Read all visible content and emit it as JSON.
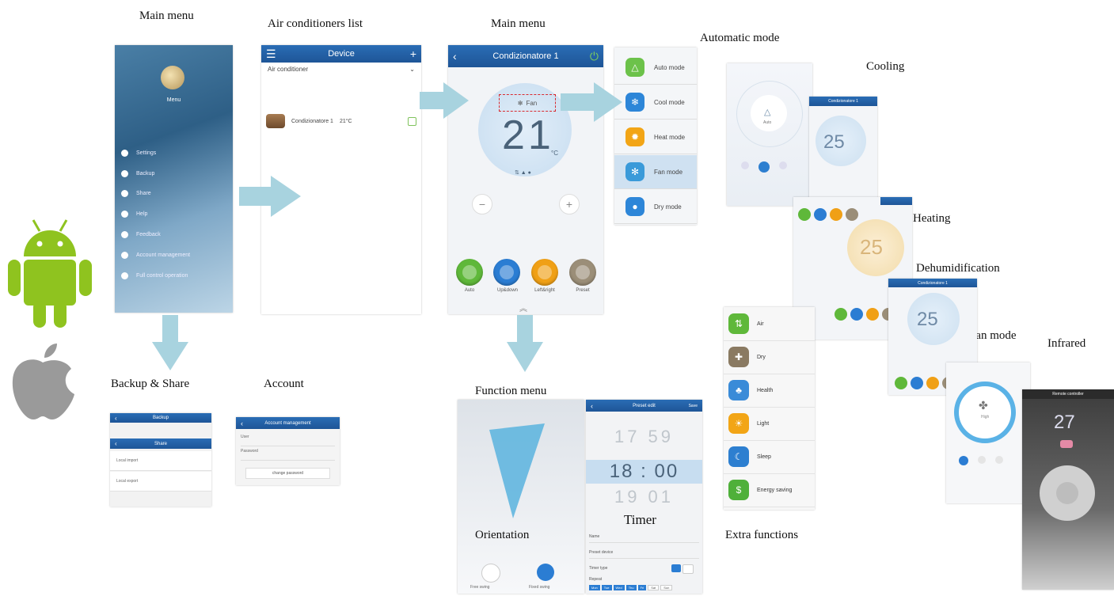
{
  "captions": {
    "main_menu_1": "Main menu",
    "ac_list": "Air conditioners list",
    "main_menu_2": "Main menu",
    "automatic_mode": "Automatic  mode",
    "cooling": "Cooling",
    "heating": "Heating",
    "dehumidification": "Dehumidification",
    "fan_mode": "Fan mode",
    "infrared": "Infrared",
    "backup_share": "Backup & Share",
    "account": "Account",
    "function_menu": "Function menu",
    "orientation": "Orientation",
    "timer": "Timer",
    "extra_functions": "Extra functions"
  },
  "side_menu": {
    "user": "Menu",
    "items": [
      "Settings",
      "Backup",
      "Share",
      "Help",
      "Feedback",
      "Account management",
      "Full control operation"
    ]
  },
  "device_list": {
    "title": "Device",
    "section": "Air conditioner",
    "item_name": "Condizionatore 1",
    "item_temp": "21°C"
  },
  "control": {
    "title": "Condizionatore 1",
    "mode": "Fan",
    "temperature": "21",
    "unit": "°C",
    "minus": "−",
    "plus": "+",
    "buttons": [
      "Auto",
      "Up&down",
      "Left&right",
      "Preset"
    ]
  },
  "modes": {
    "items": [
      "Auto mode",
      "Cool mode",
      "Heat mode",
      "Fan mode",
      "Dry mode"
    ],
    "colors": [
      "#6cc24a",
      "#2d86d8",
      "#f2a516",
      "#3a9ad9",
      "#2d86d8"
    ]
  },
  "thumb": {
    "cool_temp": "25",
    "heat_temp": "25",
    "dry_temp": "25",
    "ir_temp": "27",
    "auto_label": "Auto",
    "fan_label": "High",
    "cool_title": "Condizionatore 1",
    "dry_title": "Condizionatore 1",
    "ir_title": "Remote controller"
  },
  "extra_functions": {
    "items": [
      "Air",
      "Dry",
      "Health",
      "Light",
      "Sleep",
      "Energy saving"
    ],
    "colors": [
      "#5fb83a",
      "#8a7a62",
      "#3a8bd8",
      "#f2a516",
      "#2d7fd0",
      "#4fb03a"
    ]
  },
  "backup": {
    "title": "Backup",
    "share_title": "Share",
    "rows": [
      "Local import",
      "Local export"
    ]
  },
  "account": {
    "title": "Account management",
    "user": "User",
    "password": "Password",
    "change": "change password"
  },
  "timer": {
    "title": "Preset edit",
    "save": "Save",
    "rows_time": [
      "17  59",
      "18 : 00",
      "19  01"
    ],
    "fields": [
      "Name",
      "Preset device",
      "Timer type",
      "Repeat"
    ],
    "days": [
      "Mon",
      "Tue",
      "Wed",
      "Thu",
      "Fri",
      "Sat",
      "Sun"
    ]
  },
  "orientation": {
    "btn1": "Free swing",
    "btn2": "Fixed swing"
  }
}
